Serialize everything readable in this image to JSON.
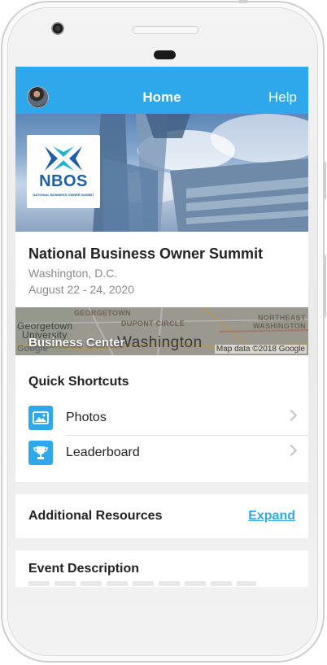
{
  "nav": {
    "title": "Home",
    "help_label": "Help",
    "accent_color": "#2ea8ea"
  },
  "event": {
    "logo_text": "NBOS",
    "logo_subtext": "NATIONAL BUSINESS OWNER SUMMIT",
    "title": "National Business Owner Summit",
    "location": "Washington, D.C.",
    "dates": "August 22 - 24, 2020"
  },
  "map": {
    "venue": "Business Center",
    "city_label": "Washington",
    "attribution": "Map data ©2018 Google",
    "google_label": "Google",
    "labels": {
      "georgetown": "GEORGETOWN",
      "georgetown_univ": "Georgetown",
      "university": "University",
      "dupont": "DUPONT CIRCLE",
      "northeast": "NORTHEAST",
      "northeast_city": "WASHINGTON"
    }
  },
  "shortcuts": {
    "title": "Quick Shortcuts",
    "items": [
      {
        "label": "Photos",
        "icon": "photo-icon"
      },
      {
        "label": "Leaderboard",
        "icon": "trophy-icon"
      }
    ]
  },
  "resources": {
    "title": "Additional Resources",
    "expand_label": "Expand"
  },
  "description": {
    "title": "Event Description"
  }
}
